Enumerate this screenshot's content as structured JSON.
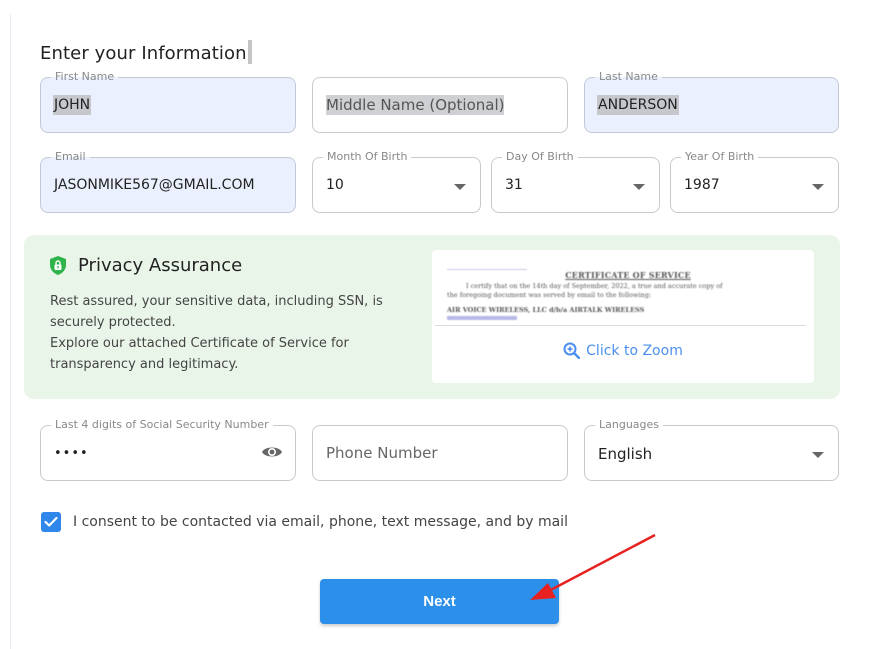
{
  "form": {
    "title": "Enter your Information",
    "first_name": {
      "label": "First Name",
      "value": "JOHN"
    },
    "middle_name": {
      "placeholder": "Middle Name (Optional)"
    },
    "last_name": {
      "label": "Last Name",
      "value": "ANDERSON"
    },
    "email": {
      "label": "Email",
      "value": "JASONMIKE567@GMAIL.COM"
    },
    "month_of_birth": {
      "label": "Month Of Birth",
      "value": "10"
    },
    "day_of_birth": {
      "label": "Day Of Birth",
      "value": "31"
    },
    "year_of_birth": {
      "label": "Year Of Birth",
      "value": "1987"
    },
    "ssn_last4": {
      "label": "Last 4 digits of Social Security Number",
      "value": "••••"
    },
    "phone": {
      "placeholder": "Phone Number"
    },
    "language": {
      "label": "Languages",
      "value": "English"
    }
  },
  "privacy": {
    "icon": "shield-lock-icon",
    "title": "Privacy Assurance",
    "line1": "Rest assured, your sensitive data, including SSN, is securely protected.",
    "line2": "Explore our attached Certificate of Service for transparency and legitimacy.",
    "certificate": {
      "heading": "CERTIFICATE OF SERVICE",
      "line1": "I certify that on the 14th day of September, 2022, a true and accurate copy of",
      "line2": "the foregoing document was served by email to the following:",
      "line3": "AIR VOICE WIRELESS, LLC d/b/a AIRTALK WIRELESS",
      "zoom_label": "Click to Zoom",
      "zoom_icon": "zoom-in-icon"
    }
  },
  "consent": {
    "checked": true,
    "label": "I consent to be contacted via email, phone, text message, and by mail"
  },
  "actions": {
    "next_label": "Next"
  },
  "colors": {
    "accent": "#2c90ea",
    "filled_field": "#eaf0fd",
    "privacy_bg": "#eaf5ea",
    "shield": "#2fb34a",
    "annotation_arrow": "#e8201f"
  }
}
